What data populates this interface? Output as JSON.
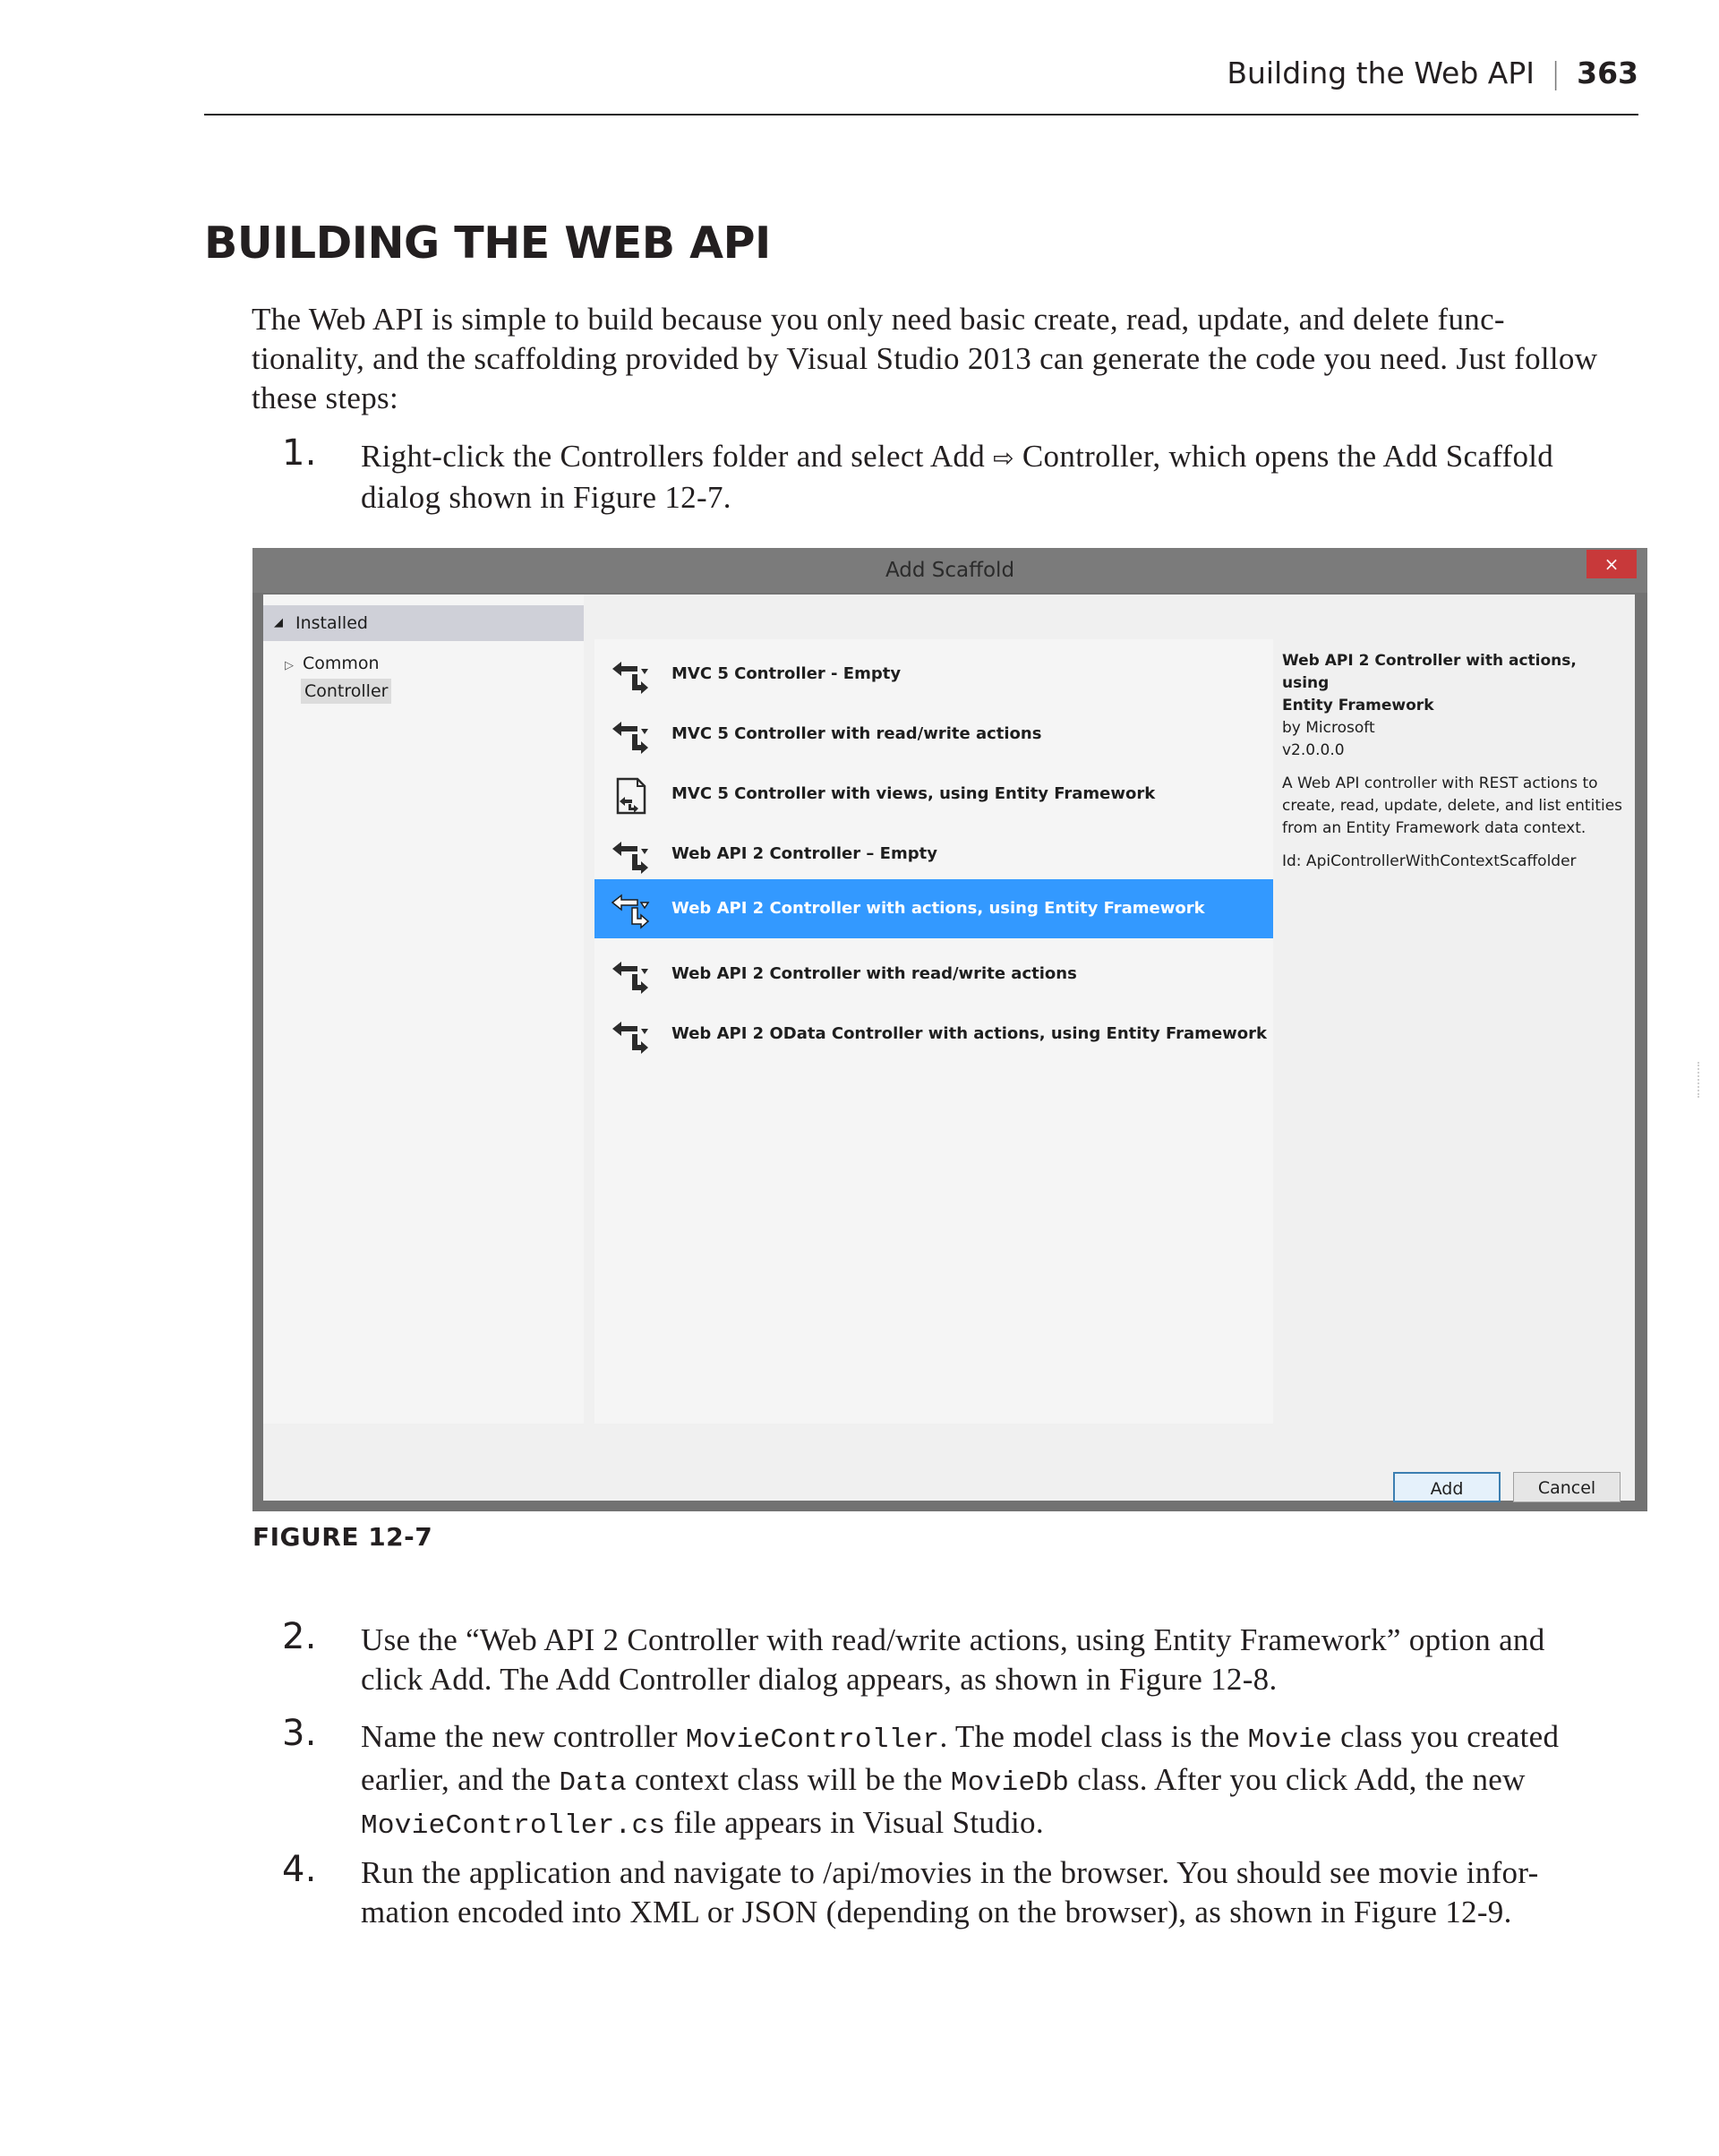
{
  "running_head": {
    "title": "Building the Web API",
    "separator": "|",
    "page_number": "363"
  },
  "section": {
    "title": "BUILDING THE WEB API"
  },
  "intro": "The Web API is simple to build because you only need basic create, read, update, and delete func-tionality, and the scaffolding provided by Visual Studio 2013 can generate the code you need. Just follow these steps:",
  "step1": {
    "number": "1.",
    "text_a": "Right-click the Controllers folder and select Add ",
    "arrow": "⇨",
    "text_b": " Controller, which opens the Add Scaffold dialog shown in Figure 12-7."
  },
  "dialog": {
    "title": "Add Scaffold",
    "close_glyph": "×",
    "tree": {
      "installed": "Installed",
      "installed_glyph": "◢",
      "common": "Common",
      "common_glyph": "▷",
      "controller": "Controller"
    },
    "templates": [
      {
        "name": "MVC 5 Controller - Empty",
        "icon": "controller-icon",
        "selected": false
      },
      {
        "name": "MVC 5 Controller with read/write actions",
        "icon": "controller-icon",
        "selected": false
      },
      {
        "name": "MVC 5 Controller with views, using Entity Framework",
        "icon": "view-controller-icon",
        "selected": false
      },
      {
        "name": "Web API 2 Controller – Empty",
        "icon": "controller-icon",
        "selected": false
      },
      {
        "name": "Web API 2 Controller with actions, using Entity Framework",
        "icon": "controller-icon",
        "selected": true
      },
      {
        "name": "Web API 2 Controller with read/write actions",
        "icon": "controller-icon",
        "selected": false
      },
      {
        "name": "Web API 2 OData Controller with actions, using Entity Framework",
        "icon": "controller-icon",
        "selected": false
      }
    ],
    "details": {
      "title_line1": "Web API 2 Controller with actions, using",
      "title_line2": "Entity Framework",
      "author": "by Microsoft",
      "version": "v2.0.0.0",
      "desc_line1": "A Web API controller with REST actions to",
      "desc_line2": "create, read, update, delete, and list entities",
      "desc_line3": "from an Entity Framework data context.",
      "id": "Id: ApiControllerWithContextScaffolder"
    },
    "buttons": {
      "add": "Add",
      "cancel": "Cancel"
    }
  },
  "figure_caption": "FIGURE 12-7",
  "step2": {
    "number": "2.",
    "text": "Use the “Web API 2 Controller with read/write actions, using Entity Framework” option and click Add. The Add Controller dialog appears, as shown in Figure 12-8."
  },
  "step3": {
    "number": "3.",
    "t1": "Name the new controller ",
    "c1": "MovieController",
    "t2": ". The model class is the ",
    "c2": "Movie",
    "t3": " class you created earlier, and the ",
    "c3": "Data",
    "t4": " context class will be the ",
    "c4": "MovieDb",
    "t5": " class. After you click Add, the new ",
    "c5": "MovieController.cs",
    "t6": " file appears in Visual Studio."
  },
  "step4": {
    "number": "4.",
    "text": "Run the application and navigate to /api/movies in the browser. You should see movie infor-mation encoded into XML or JSON (depending on the browser), as shown in Figure 12-9."
  },
  "colors": {
    "selection": "#3399ff",
    "close_button": "#c8393a",
    "dialog_frame": "#727272"
  }
}
